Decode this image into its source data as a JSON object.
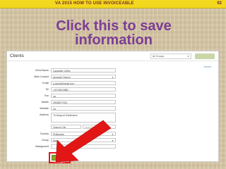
{
  "banner": {
    "title": "VA 2015    HOW TO USE INVOICEABLE",
    "page": "92",
    "color": "#f2d81e"
  },
  "callout": {
    "line1": "Click this to save",
    "line2": "information",
    "color": "#7c3d96"
  },
  "screenshot": {
    "title": "Clients",
    "group_select": "All Groups",
    "cancel_link": "Cancel",
    "form": {
      "client_name": {
        "label": "Client Name",
        "value": "Carabelle Coffee"
      },
      "main_contact": {
        "label": "Main Contact",
        "value": "Amanda Chacon"
      },
      "email": {
        "label": "Email",
        "value": "a.carola@gmail.com"
      },
      "tel": {
        "label": "Tel",
        "value": "+02 0961/0881"
      },
      "fax": {
        "label": "Fax",
        "value": "na"
      },
      "mobile": {
        "label": "Mobile",
        "value": "09158977024"
      },
      "website": {
        "label": "Website",
        "value": "na"
      },
      "address": {
        "label": "Address",
        "value": "76 Newport Subdivision"
      },
      "city": {
        "value": "Quezon City"
      },
      "state": {
        "placeholder": "State/Province/Region"
      },
      "country": {
        "label": "Country",
        "value": "Philippines"
      },
      "group": {
        "label": "Group",
        "value": "None"
      },
      "background": {
        "label": "Background",
        "value": ""
      }
    },
    "save_button": "Save Changes",
    "highlight_color": "#e31616"
  }
}
